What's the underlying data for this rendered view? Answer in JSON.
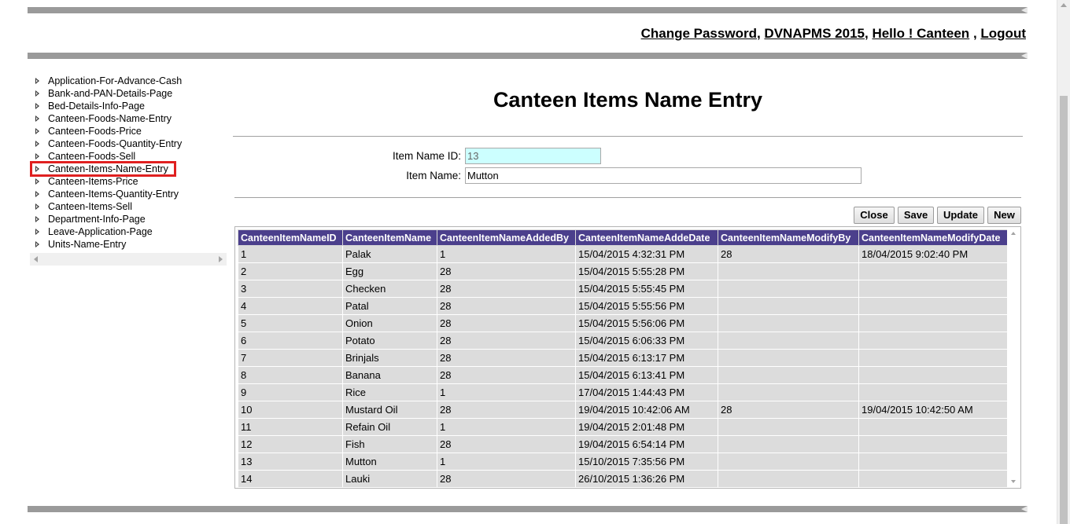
{
  "header": {
    "change_password": "Change Password",
    "sep1": ",",
    "app_name": "DVNAPMS 2015",
    "sep2": ",",
    "greeting": "Hello ! Canteen",
    "sep3": ",",
    "logout": "Logout"
  },
  "sidebar": {
    "items": [
      {
        "label": "Application-For-Advance-Cash"
      },
      {
        "label": "Bank-and-PAN-Details-Page"
      },
      {
        "label": "Bed-Details-Info-Page"
      },
      {
        "label": "Canteen-Foods-Name-Entry"
      },
      {
        "label": "Canteen-Foods-Price"
      },
      {
        "label": "Canteen-Foods-Quantity-Entry"
      },
      {
        "label": "Canteen-Foods-Sell"
      },
      {
        "label": "Canteen-Items-Name-Entry"
      },
      {
        "label": "Canteen-Items-Price"
      },
      {
        "label": "Canteen-Items-Quantity-Entry"
      },
      {
        "label": "Canteen-Items-Sell"
      },
      {
        "label": "Department-Info-Page"
      },
      {
        "label": "Leave-Application-Page"
      },
      {
        "label": "Units-Name-Entry"
      }
    ],
    "selected_index": 7
  },
  "main": {
    "title": "Canteen Items Name Entry",
    "form": {
      "item_id_label": "Item Name ID:",
      "item_id_value": "13",
      "item_name_label": "Item Name:",
      "item_name_value": "Mutton"
    },
    "buttons": {
      "close": "Close",
      "save": "Save",
      "update": "Update",
      "new": "New"
    },
    "grid": {
      "columns": [
        "CanteenItemNameID",
        "CanteenItemName",
        "CanteenItemNameAddedBy",
        "CanteenItemNameAddeDate",
        "CanteenItemNameModifyBy",
        "CanteenItemNameModifyDate"
      ],
      "rows": [
        [
          "1",
          "Palak",
          "1",
          "15/04/2015 4:32:31 PM",
          "28",
          "18/04/2015 9:02:40 PM"
        ],
        [
          "2",
          "Egg",
          "28",
          "15/04/2015 5:55:28 PM",
          "",
          ""
        ],
        [
          "3",
          "Checken",
          "28",
          "15/04/2015 5:55:45 PM",
          "",
          ""
        ],
        [
          "4",
          "Patal",
          "28",
          "15/04/2015 5:55:56 PM",
          "",
          ""
        ],
        [
          "5",
          "Onion",
          "28",
          "15/04/2015 5:56:06 PM",
          "",
          ""
        ],
        [
          "6",
          "Potato",
          "28",
          "15/04/2015 6:06:33 PM",
          "",
          ""
        ],
        [
          "7",
          "Brinjals",
          "28",
          "15/04/2015 6:13:17 PM",
          "",
          ""
        ],
        [
          "8",
          "Banana",
          "28",
          "15/04/2015 6:13:41 PM",
          "",
          ""
        ],
        [
          "9",
          "Rice",
          "1",
          "17/04/2015 1:44:43 PM",
          "",
          ""
        ],
        [
          "10",
          "Mustard Oil",
          "28",
          "19/04/2015 10:42:06 AM",
          "28",
          "19/04/2015 10:42:50 AM"
        ],
        [
          "11",
          "Refain Oil",
          "1",
          "19/04/2015 2:01:48 PM",
          "",
          ""
        ],
        [
          "12",
          "Fish",
          "28",
          "19/04/2015 6:54:14 PM",
          "",
          ""
        ],
        [
          "13",
          "Mutton",
          "1",
          "15/10/2015 7:35:56 PM",
          "",
          ""
        ],
        [
          "14",
          "Lauki",
          "28",
          "26/10/2015 1:36:26 PM",
          "",
          ""
        ]
      ]
    }
  }
}
